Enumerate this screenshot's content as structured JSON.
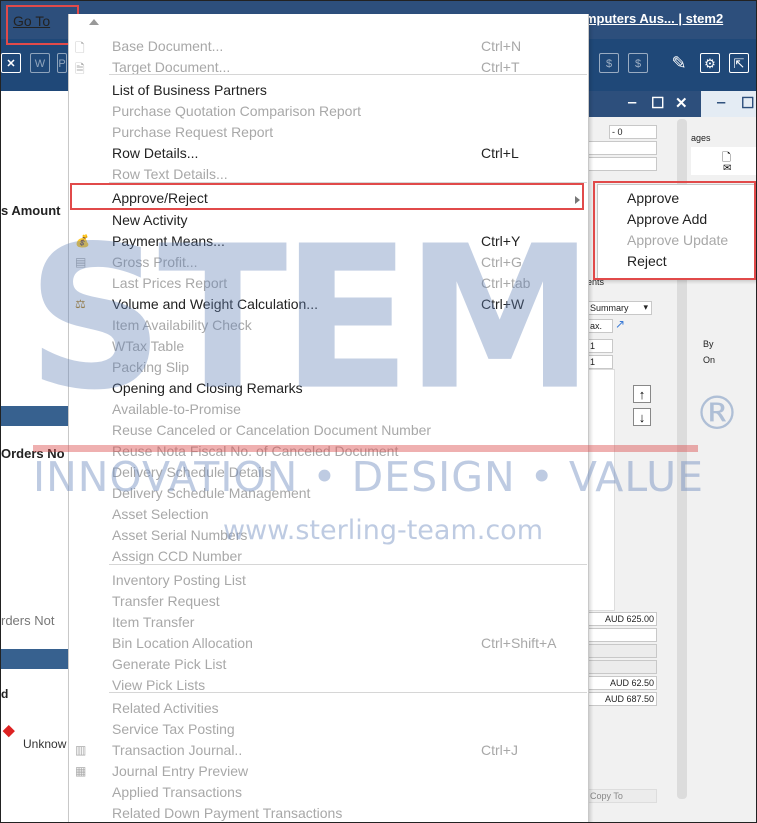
{
  "app": {
    "title": "omputers Aus... | stem2",
    "goto_label": "Go To",
    "toolbar_icons": [
      "close-x-icon",
      "word-icon",
      "pdf-icon",
      "currency-icon",
      "search-currency-icon",
      "edit-icon",
      "settings-doc-icon",
      "export-icon"
    ]
  },
  "left_panel": {
    "amount_label": "s Amount",
    "orders_label": "Orders No",
    "orders_not_label": "rders Not",
    "status_label": "Unknow",
    "d_label": "d"
  },
  "right_form": {
    "field_dash": "- 0",
    "pages_label": "ages",
    "ents_label": "ents",
    "summary_label": "Summary",
    "tax_label": "ax.",
    "field_one_a": "1",
    "field_one_b": "1",
    "by_label": "By",
    "on_label": "On",
    "amount_1": "AUD 625.00",
    "amount_2": "AUD 62.50",
    "amount_3": "AUD 687.50",
    "copy_to": "Copy To"
  },
  "menu": {
    "items": [
      {
        "label": "Base Document...",
        "shortcut": "Ctrl+N",
        "enabled": false,
        "icon": "base-doc-icon"
      },
      {
        "label": "Target Document...",
        "shortcut": "Ctrl+T",
        "enabled": false,
        "icon": "target-doc-icon"
      },
      {
        "label": "List of Business Partners",
        "shortcut": "",
        "enabled": true,
        "icon": ""
      },
      {
        "label": "Purchase Quotation Comparison Report",
        "shortcut": "",
        "enabled": false,
        "icon": ""
      },
      {
        "label": "Purchase Request Report",
        "shortcut": "",
        "enabled": false,
        "icon": ""
      },
      {
        "label": "Row Details...",
        "shortcut": "Ctrl+L",
        "enabled": true,
        "icon": ""
      },
      {
        "label": "Row Text Details...",
        "shortcut": "",
        "enabled": false,
        "icon": ""
      },
      {
        "label": "Approve/Reject",
        "shortcut": "",
        "enabled": true,
        "icon": ""
      },
      {
        "label": "New Activity",
        "shortcut": "",
        "enabled": true,
        "icon": ""
      },
      {
        "label": "Payment Means...",
        "shortcut": "Ctrl+Y",
        "enabled": true,
        "icon": "payment-means-icon"
      },
      {
        "label": "Gross Profit...",
        "shortcut": "Ctrl+G",
        "enabled": false,
        "icon": "gross-profit-icon"
      },
      {
        "label": "Last Prices Report",
        "shortcut": "Ctrl+tab",
        "enabled": false,
        "icon": ""
      },
      {
        "label": "Volume and Weight Calculation...",
        "shortcut": "Ctrl+W",
        "enabled": true,
        "icon": "volume-weight-icon"
      },
      {
        "label": "Item Availability Check",
        "shortcut": "",
        "enabled": false,
        "icon": ""
      },
      {
        "label": "WTax Table",
        "shortcut": "",
        "enabled": false,
        "icon": ""
      },
      {
        "label": "Packing Slip",
        "shortcut": "",
        "enabled": false,
        "icon": ""
      },
      {
        "label": "Opening and Closing Remarks",
        "shortcut": "",
        "enabled": true,
        "icon": ""
      },
      {
        "label": "Available-to-Promise",
        "shortcut": "",
        "enabled": false,
        "icon": ""
      },
      {
        "label": "Reuse Canceled or Cancelation Document Number",
        "shortcut": "",
        "enabled": false,
        "icon": ""
      },
      {
        "label": "Reuse Nota Fiscal No. of Canceled Document",
        "shortcut": "",
        "enabled": false,
        "icon": ""
      },
      {
        "label": "Delivery Schedule Details",
        "shortcut": "",
        "enabled": false,
        "icon": ""
      },
      {
        "label": "Delivery Schedule Management",
        "shortcut": "",
        "enabled": false,
        "icon": ""
      },
      {
        "label": "Asset Selection",
        "shortcut": "",
        "enabled": false,
        "icon": ""
      },
      {
        "label": "Asset Serial Numbers",
        "shortcut": "",
        "enabled": false,
        "icon": ""
      },
      {
        "label": "Assign CCD Number",
        "shortcut": "",
        "enabled": false,
        "icon": ""
      },
      {
        "label": "Inventory Posting List",
        "shortcut": "",
        "enabled": false,
        "icon": ""
      },
      {
        "label": "Transfer Request",
        "shortcut": "",
        "enabled": false,
        "icon": ""
      },
      {
        "label": "Item Transfer",
        "shortcut": "",
        "enabled": false,
        "icon": ""
      },
      {
        "label": "Bin Location Allocation",
        "shortcut": "Ctrl+Shift+A",
        "enabled": false,
        "icon": ""
      },
      {
        "label": "Generate Pick List",
        "shortcut": "",
        "enabled": false,
        "icon": ""
      },
      {
        "label": "View Pick Lists",
        "shortcut": "",
        "enabled": false,
        "icon": ""
      },
      {
        "label": "Related Activities",
        "shortcut": "",
        "enabled": false,
        "icon": ""
      },
      {
        "label": "Service Tax Posting",
        "shortcut": "",
        "enabled": false,
        "icon": ""
      },
      {
        "label": "Transaction Journal..",
        "shortcut": "Ctrl+J",
        "enabled": false,
        "icon": "transaction-journal-icon"
      },
      {
        "label": "Journal Entry Preview",
        "shortcut": "",
        "enabled": false,
        "icon": "journal-preview-icon"
      },
      {
        "label": "Applied Transactions",
        "shortcut": "",
        "enabled": false,
        "icon": ""
      },
      {
        "label": "Related Down Payment Transactions",
        "shortcut": "",
        "enabled": false,
        "icon": ""
      }
    ]
  },
  "submenu": {
    "items": [
      {
        "label": "Approve",
        "enabled": true
      },
      {
        "label": "Approve  Add",
        "enabled": true
      },
      {
        "label": "Approve  Update",
        "enabled": false
      },
      {
        "label": "Reject",
        "enabled": true
      }
    ]
  },
  "watermark": {
    "logo": "STEM",
    "registered": "®",
    "tagline": "INNOVATION • DESIGN • VALUE",
    "url": "www.sterling-team.com"
  }
}
